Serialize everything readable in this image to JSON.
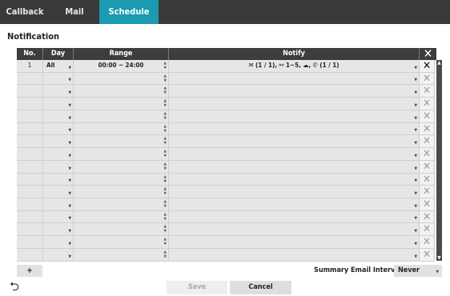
{
  "tabs": [
    {
      "label": "Callback",
      "active": false
    },
    {
      "label": "Mail",
      "active": false
    },
    {
      "label": "Schedule",
      "active": true
    }
  ],
  "section_title": "Notification",
  "table": {
    "headers": {
      "no": "No.",
      "day": "Day",
      "range": "Range",
      "notify": "Notify",
      "delete_icon": "close-icon"
    },
    "rows": [
      {
        "no": "1",
        "day": "All",
        "range": "00:00 ~ 24:00",
        "notify": "✉ (1 / 1), ⚯ 1~5, ☁, ✆ (1 / 1)"
      },
      {
        "no": "",
        "day": "",
        "range": "",
        "notify": ""
      },
      {
        "no": "",
        "day": "",
        "range": "",
        "notify": ""
      },
      {
        "no": "",
        "day": "",
        "range": "",
        "notify": ""
      },
      {
        "no": "",
        "day": "",
        "range": "",
        "notify": ""
      },
      {
        "no": "",
        "day": "",
        "range": "",
        "notify": ""
      },
      {
        "no": "",
        "day": "",
        "range": "",
        "notify": ""
      },
      {
        "no": "",
        "day": "",
        "range": "",
        "notify": ""
      },
      {
        "no": "",
        "day": "",
        "range": "",
        "notify": ""
      },
      {
        "no": "",
        "day": "",
        "range": "",
        "notify": ""
      },
      {
        "no": "",
        "day": "",
        "range": "",
        "notify": ""
      },
      {
        "no": "",
        "day": "",
        "range": "",
        "notify": ""
      },
      {
        "no": "",
        "day": "",
        "range": "",
        "notify": ""
      },
      {
        "no": "",
        "day": "",
        "range": "",
        "notify": ""
      },
      {
        "no": "",
        "day": "",
        "range": "",
        "notify": ""
      },
      {
        "no": "",
        "day": "",
        "range": "",
        "notify": ""
      }
    ]
  },
  "add_label": "+",
  "summary": {
    "label": "Summary Email Interval",
    "value": "Never"
  },
  "buttons": {
    "save": "Save",
    "cancel": "Cancel",
    "back_icon": "back-arrow-icon"
  },
  "colors": {
    "accent": "#1a9bb0",
    "tabbar": "#3a3a3a",
    "header": "#3d3d3d"
  }
}
